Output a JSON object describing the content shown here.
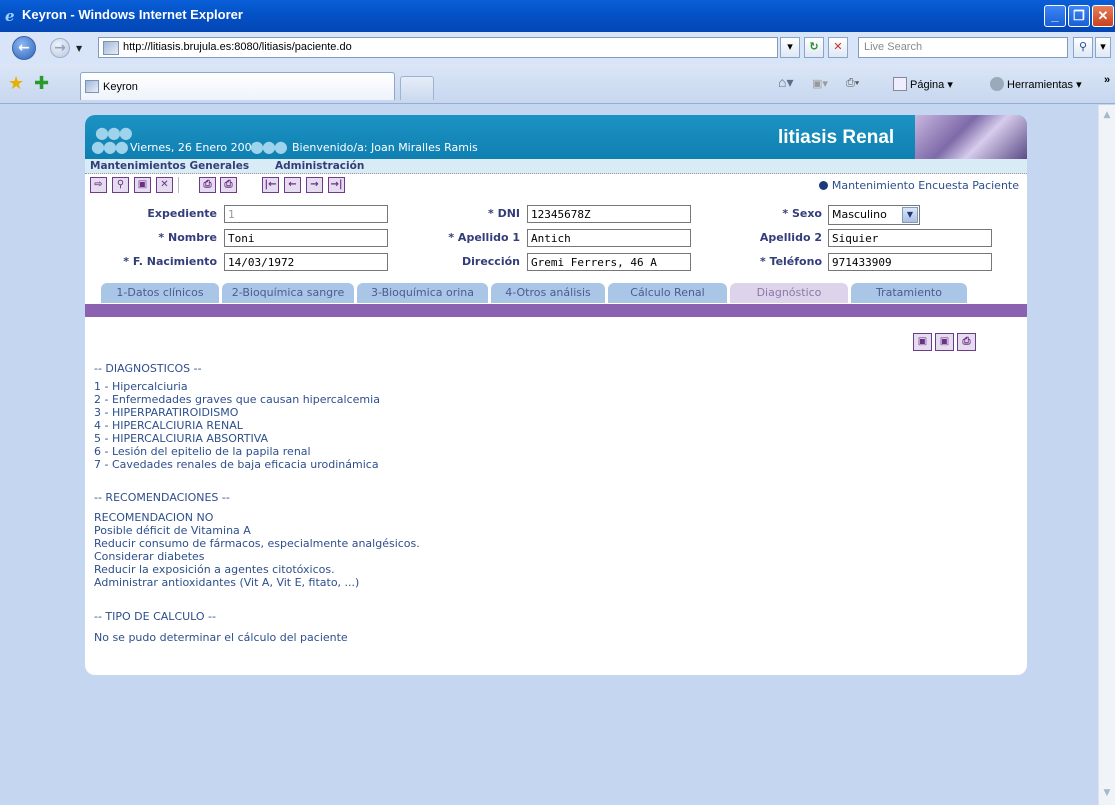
{
  "window": {
    "title": "Keyron - Windows Internet Explorer",
    "url": "http://litiasis.brujula.es:8080/litiasis/paciente.do",
    "search_placeholder": "Live Search",
    "tab_label": "Keyron",
    "cmd_pagina": "Página",
    "cmd_herramientas": "Herramientas",
    "cmd_more": "»"
  },
  "banner": {
    "date": "Viernes, 26 Enero 2007",
    "welcome": "Bienvenido/a: Joan Miralles Ramis",
    "brand": "litiasis Renal"
  },
  "menu": {
    "item1": "Mantenimientos Generales",
    "item2": "Administración"
  },
  "toolbar": {
    "survey_link": "Mantenimiento Encuesta Paciente"
  },
  "form": {
    "expediente_label": "Expediente",
    "expediente_value": "1",
    "dni_label": "* DNI",
    "dni_value": "12345678Z",
    "sexo_label": "* Sexo",
    "sexo_value": "Masculino",
    "nombre_label": "* Nombre",
    "nombre_value": "Toni",
    "apellido1_label": "* Apellido 1",
    "apellido1_value": "Antich",
    "apellido2_label": "Apellido 2",
    "apellido2_value": "Siquier",
    "nacimiento_label": "* F. Nacimiento",
    "nacimiento_value": "14/03/1972",
    "direccion_label": "Dirección",
    "direccion_value": "Gremi Ferrers, 46 A",
    "telefono_label": "* Teléfono",
    "telefono_value": "971433909"
  },
  "tabs": [
    {
      "label": "1-Datos clínicos"
    },
    {
      "label": "2-Bioquímica sangre"
    },
    {
      "label": "3-Bioquímica orina"
    },
    {
      "label": "4-Otros análisis"
    },
    {
      "label": "Cálculo Renal"
    },
    {
      "label": "Diagnóstico"
    },
    {
      "label": "Tratamiento"
    }
  ],
  "content": {
    "diag_header": "-- DIAGNOSTICOS --",
    "diagnostics": [
      "1 - Hipercalciuria",
      "2 - Enfermedades graves que causan hipercalcemia",
      "3 - HIPERPARATIROIDISMO",
      "4 - HIPERCALCIURIA RENAL",
      "5 - HIPERCALCIURIA ABSORTIVA",
      "6 - Lesión del epitelio de la papila renal",
      "7 - Cavedades renales de baja eficacia urodinámica"
    ],
    "rec_header": "-- RECOMENDACIONES --",
    "recommendations": [
      "RECOMENDACION NO",
      "Posible déficit de Vitamina A",
      "Reducir consumo de fármacos, especialmente analgésicos.",
      "Considerar diabetes",
      "Reducir la exposición a agentes citotóxicos.",
      "Administrar antioxidantes (Vit A, Vit E, fitato, ...)"
    ],
    "calc_header": "-- TIPO DE CALCULO --",
    "calc_text": "No se pudo determinar el cálculo del paciente"
  },
  "colors": {
    "banner": "#1388bb",
    "purple_bar": "#8a62b0",
    "tab": "#a9c6e6",
    "tab_active": "#ddd3ea",
    "text_blue": "#2e4f8c"
  }
}
